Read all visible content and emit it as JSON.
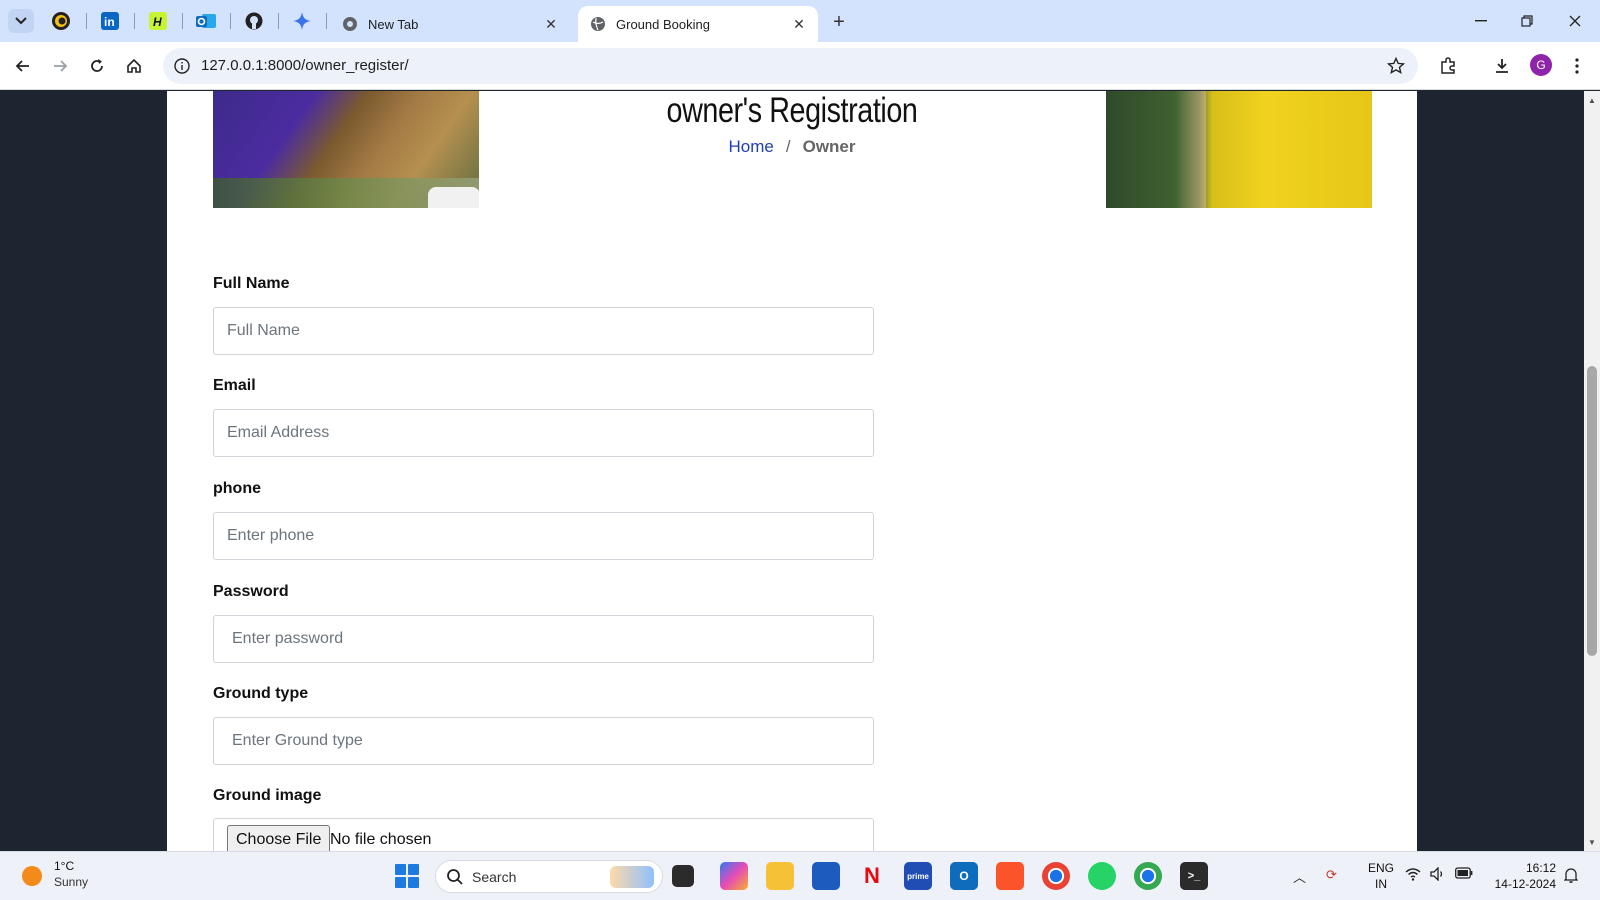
{
  "browser": {
    "tabs": [
      {
        "title": "New Tab",
        "active": false
      },
      {
        "title": "Ground Booking",
        "active": true
      }
    ],
    "url": "127.0.0.1:8000/owner_register/",
    "profile_initial": "G"
  },
  "page": {
    "title": "owner's Registration",
    "breadcrumb": {
      "home": "Home",
      "separator": "/",
      "current": "Owner"
    },
    "form": {
      "full_name": {
        "label": "Full Name",
        "placeholder": "Full Name"
      },
      "email": {
        "label": "Email",
        "placeholder": "Email Address"
      },
      "phone": {
        "label": "phone",
        "placeholder": "Enter phone"
      },
      "password": {
        "label": "Password",
        "placeholder": "Enter password"
      },
      "ground_type": {
        "label": "Ground type",
        "placeholder": "Enter Ground type"
      },
      "ground_image": {
        "label": "Ground image",
        "button": "Choose File",
        "status": "No file chosen"
      }
    }
  },
  "taskbar": {
    "weather": {
      "temp": "1°C",
      "desc": "Sunny"
    },
    "search_label": "Search",
    "language": {
      "line1": "ENG",
      "line2": "IN"
    },
    "time": "16:12",
    "date": "14-12-2024"
  },
  "colors": {
    "tabstrip": "#d3e3fd",
    "breadcrumb_link": "#1f3fb5",
    "page_background": "#1f2530"
  }
}
